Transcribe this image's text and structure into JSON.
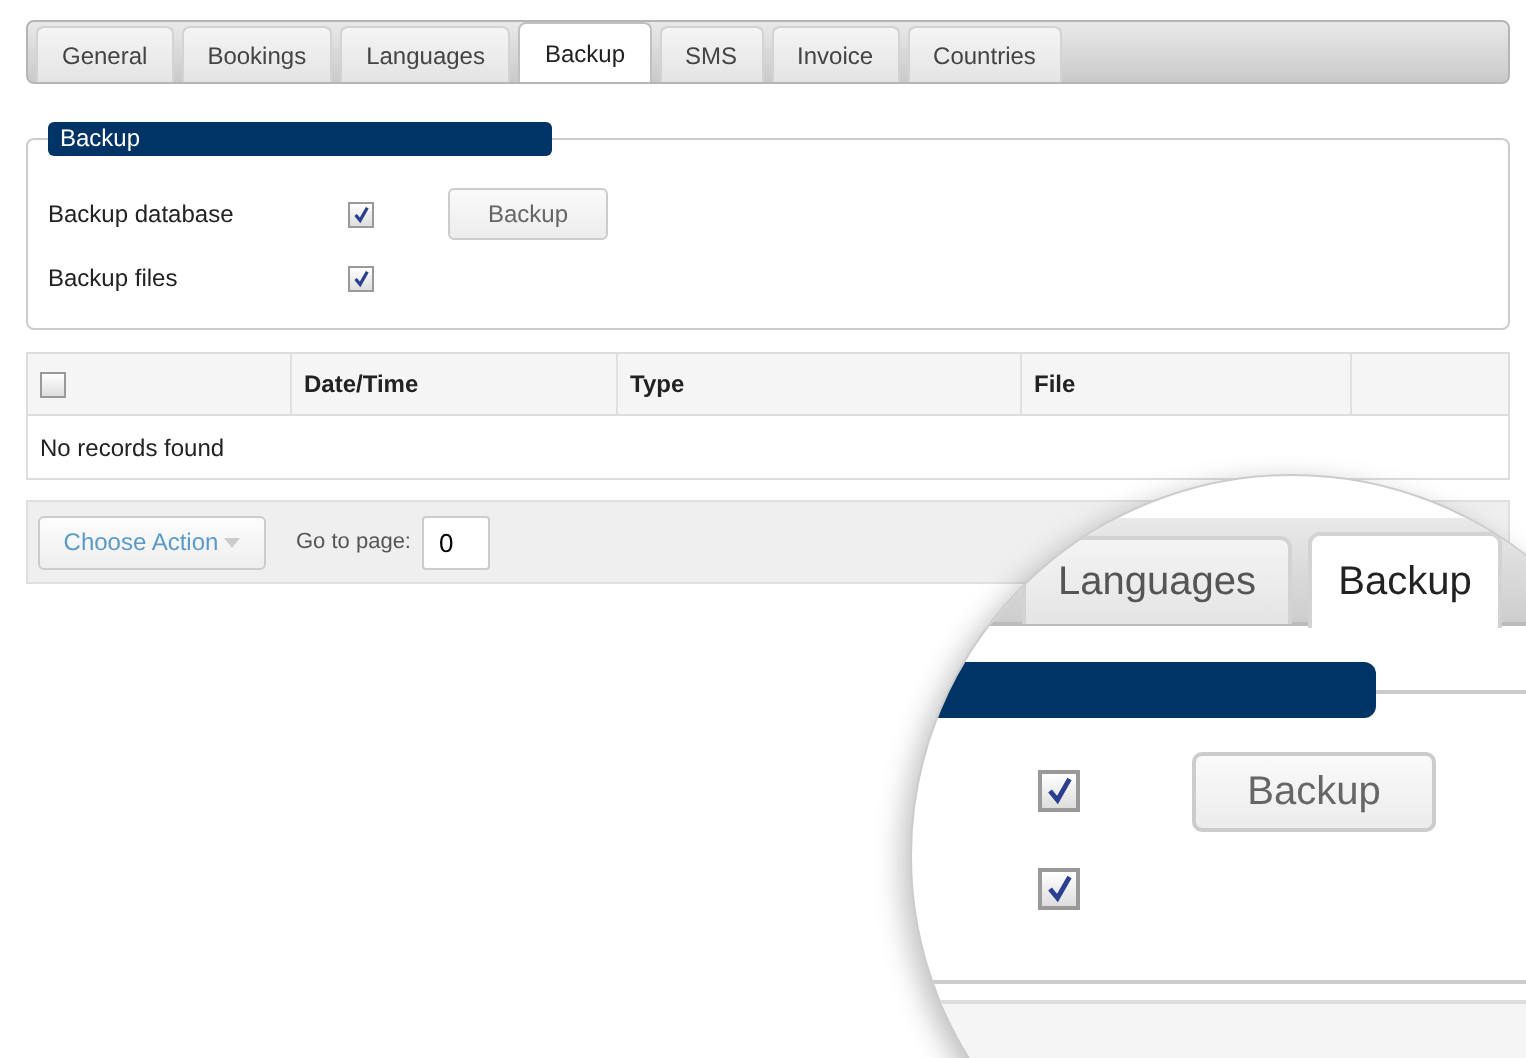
{
  "tabs": [
    {
      "label": "General",
      "selected": false
    },
    {
      "label": "Bookings",
      "selected": false
    },
    {
      "label": "Languages",
      "selected": false
    },
    {
      "label": "Backup",
      "selected": true
    },
    {
      "label": "SMS",
      "selected": false
    },
    {
      "label": "Invoice",
      "selected": false
    },
    {
      "label": "Countries",
      "selected": false
    }
  ],
  "backup": {
    "legend": "Backup",
    "options": [
      {
        "label": "Backup database",
        "checked": true
      },
      {
        "label": "Backup files",
        "checked": true
      }
    ],
    "button": "Backup"
  },
  "table": {
    "select_all": false,
    "columns": [
      "Date/Time",
      "Type",
      "File"
    ],
    "empty_message": "No records found"
  },
  "pager": {
    "action": "Choose Action",
    "goto_label": "Go to page:",
    "page": "0"
  },
  "magnifier": {
    "tabs": [
      {
        "label": "Languages",
        "selected": false
      },
      {
        "label": "Backup",
        "selected": true
      }
    ],
    "checkboxes": [
      true,
      true
    ],
    "button": "Backup"
  }
}
